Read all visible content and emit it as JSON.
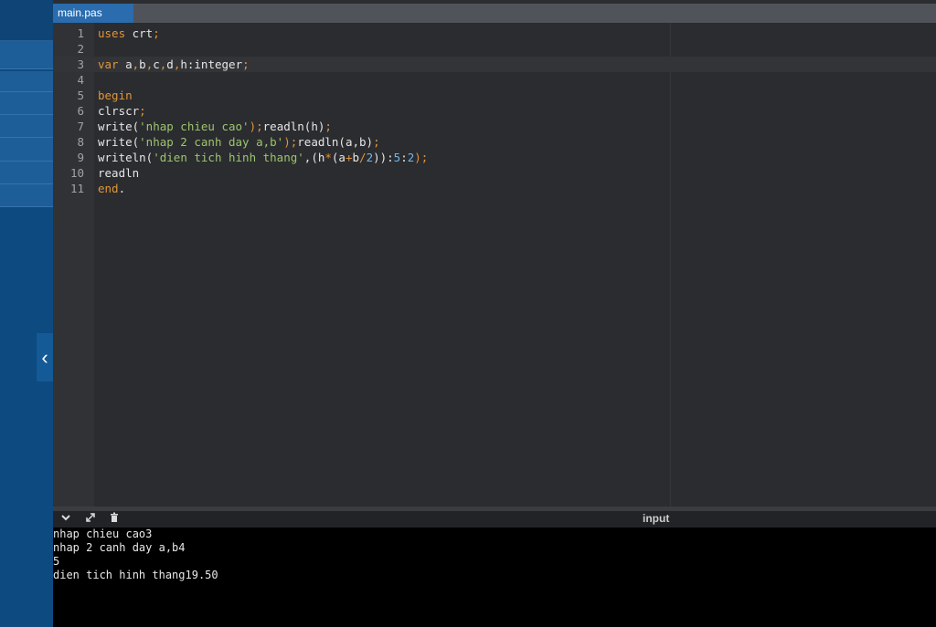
{
  "tab": {
    "filename": "main.pas"
  },
  "sidebar": {
    "collapse_glyph": "‹"
  },
  "editor": {
    "lines": [
      {
        "n": "1",
        "tokens": [
          {
            "t": "uses",
            "c": "kw"
          },
          {
            "t": " crt",
            "c": "id"
          },
          {
            "t": ";",
            "c": "punc"
          }
        ]
      },
      {
        "n": "2",
        "tokens": []
      },
      {
        "n": "3",
        "tokens": [
          {
            "t": "var",
            "c": "kw"
          },
          {
            "t": " a",
            "c": "id"
          },
          {
            "t": ",",
            "c": "punc"
          },
          {
            "t": "b",
            "c": "id"
          },
          {
            "t": ",",
            "c": "punc"
          },
          {
            "t": "c",
            "c": "id"
          },
          {
            "t": ",",
            "c": "punc"
          },
          {
            "t": "d",
            "c": "id"
          },
          {
            "t": ",",
            "c": "punc"
          },
          {
            "t": "h:integer",
            "c": "id"
          },
          {
            "t": ";",
            "c": "punc"
          }
        ]
      },
      {
        "n": "4",
        "tokens": []
      },
      {
        "n": "5",
        "tokens": [
          {
            "t": "begin",
            "c": "kw"
          }
        ]
      },
      {
        "n": "6",
        "tokens": [
          {
            "t": "clrscr",
            "c": "id"
          },
          {
            "t": ";",
            "c": "punc"
          }
        ]
      },
      {
        "n": "7",
        "tokens": [
          {
            "t": "write(",
            "c": "id"
          },
          {
            "t": "'nhap chieu cao'",
            "c": "str"
          },
          {
            "t": ");",
            "c": "punc"
          },
          {
            "t": "readln(h)",
            "c": "id"
          },
          {
            "t": ";",
            "c": "punc"
          }
        ]
      },
      {
        "n": "8",
        "tokens": [
          {
            "t": "write(",
            "c": "id"
          },
          {
            "t": "'nhap 2 canh day a,b'",
            "c": "str"
          },
          {
            "t": ");",
            "c": "punc"
          },
          {
            "t": "readln(a,b)",
            "c": "id"
          },
          {
            "t": ";",
            "c": "punc"
          }
        ]
      },
      {
        "n": "9",
        "tokens": [
          {
            "t": "writeln(",
            "c": "id"
          },
          {
            "t": "'dien tich hinh thang'",
            "c": "str"
          },
          {
            "t": ",(h",
            "c": "id"
          },
          {
            "t": "*",
            "c": "punc"
          },
          {
            "t": "(a",
            "c": "id"
          },
          {
            "t": "+",
            "c": "punc"
          },
          {
            "t": "b",
            "c": "id"
          },
          {
            "t": "/",
            "c": "punc"
          },
          {
            "t": "2",
            "c": "num"
          },
          {
            "t": ")):",
            "c": "id"
          },
          {
            "t": "5",
            "c": "num"
          },
          {
            "t": ":",
            "c": "id"
          },
          {
            "t": "2",
            "c": "num"
          },
          {
            "t": ");",
            "c": "punc"
          }
        ]
      },
      {
        "n": "10",
        "tokens": [
          {
            "t": "readln",
            "c": "id"
          }
        ]
      },
      {
        "n": "11",
        "tokens": [
          {
            "t": "end",
            "c": "kw"
          },
          {
            "t": ".",
            "c": "id"
          }
        ]
      }
    ],
    "active_line": "3"
  },
  "output": {
    "toolbar": {
      "collapse_icon": "chevron-down-icon",
      "expand_icon": "expand-icon",
      "clear_icon": "clear-icon",
      "input_label": "input"
    },
    "console_lines": [
      "nhap chieu cao3",
      "nhap 2 canh day a,b4",
      "5",
      "dien tich hinh thang19.50"
    ]
  }
}
